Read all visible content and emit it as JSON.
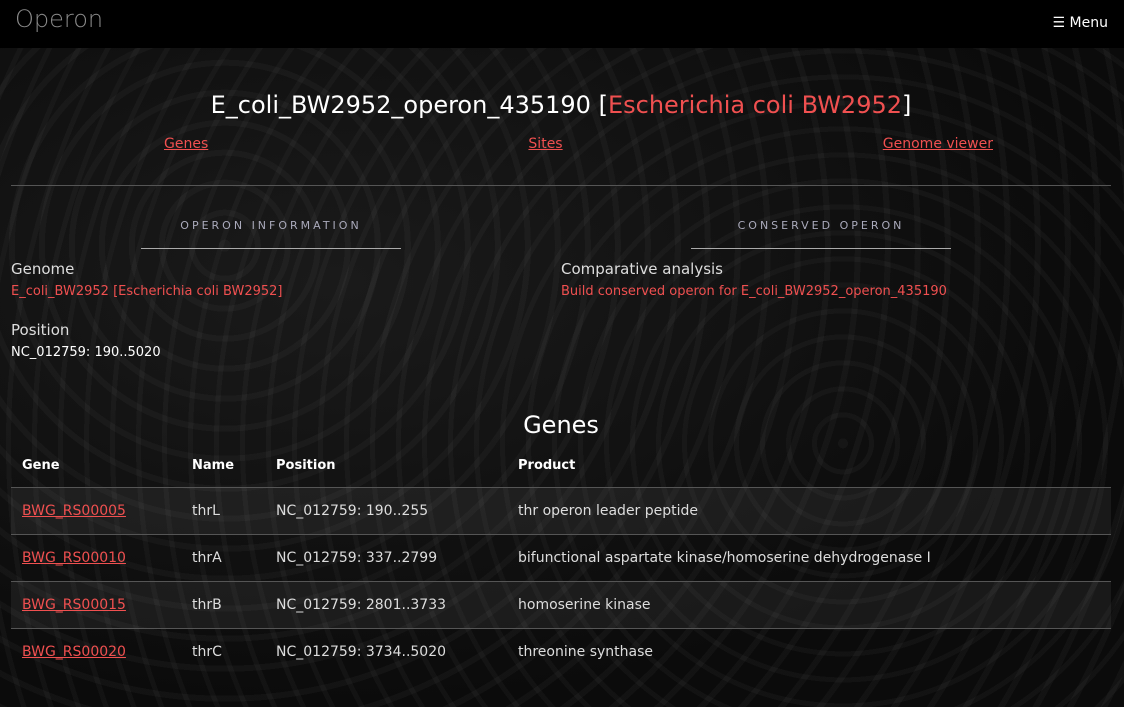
{
  "nav": {
    "brand": "Operon",
    "menu_label": "Menu",
    "menu_icon": "hamburger-icon"
  },
  "header": {
    "title_id": "E_coli_BW2952_operon_435190",
    "title_open": " [",
    "title_org": "Escherichia coli BW2952",
    "title_close": "]"
  },
  "links": [
    "Genes",
    "Sites",
    "Genome viewer"
  ],
  "info": {
    "section": "OPERON INFORMATION",
    "genome_label": "Genome",
    "genome_value": "E_coli_BW2952 [Escherichia coli BW2952]",
    "position_label": "Position",
    "position_value": "NC_012759: 190..5020"
  },
  "conserved": {
    "section": "CONSERVED OPERON",
    "label": "Comparative analysis",
    "link": "Build conserved operon for E_coli_BW2952_operon_435190"
  },
  "genes": {
    "title": "Genes",
    "columns": [
      "Gene",
      "Name",
      "Position",
      "Product"
    ],
    "rows": [
      [
        "BWG_RS00005",
        "thrL",
        "NC_012759: 190..255",
        "thr operon leader peptide"
      ],
      [
        "BWG_RS00010",
        "thrA",
        "NC_012759: 337..2799",
        "bifunctional aspartate kinase/homoserine dehydrogenase I"
      ],
      [
        "BWG_RS00015",
        "thrB",
        "NC_012759: 2801..3733",
        "homoserine kinase"
      ],
      [
        "BWG_RS00020",
        "thrC",
        "NC_012759: 3734..5020",
        "threonine synthase"
      ]
    ]
  },
  "colors": {
    "accent": "#f05050"
  }
}
